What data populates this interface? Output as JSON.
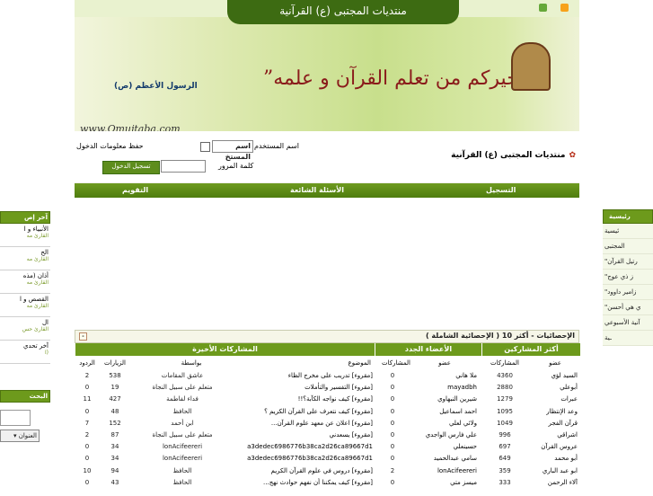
{
  "banner": {
    "header": "منتديات المجتبى (ع) القرآنية",
    "hadith": "“خيركم من تعلم القرآن و علمه”",
    "attribution": "الرسول الأعظم (ص)",
    "url": "www.Qmujtaba.com"
  },
  "login": {
    "site_title": "منتديات المجتبى (ع) القرآنية",
    "username_label": "اسم المستخدم",
    "username_value": "اسم المستخ",
    "remember_label": "حفظ معلومات الدخول",
    "password_label": "كلمة المرور",
    "login_button": "تسجيل الدخول"
  },
  "nav": {
    "register": "التسجيل",
    "faq": "الأسئلة الشائعة",
    "calendar": "التقويم"
  },
  "left_panel": {
    "head": "آخر إص",
    "items": [
      {
        "title": "الأنبياء و ا",
        "sub": "القارئ مه"
      },
      {
        "title": "الح",
        "sub": "القارئ مه"
      },
      {
        "title": "أذان (مذه",
        "sub": "القارئ مه"
      },
      {
        "title": "القصص و ا",
        "sub": "القارئ مه"
      },
      {
        "title": "ال",
        "sub": "القارئ حس"
      },
      {
        "title": "آخر تحدي",
        "sub": "(ا"
      }
    ],
    "search_head": "البحث",
    "search_option": "العنوان"
  },
  "right_panel": {
    "head": "رئيسية",
    "items": [
      "ئيسية",
      "المجتبى",
      "رتيل القرآن\"",
      "ز ذي عوج\"",
      "زامير داوود\"",
      "ي هي أحسن\"",
      "آنية الأسبوعي",
      "ـية"
    ]
  },
  "stats": {
    "title": "الإحصائيات - أكثر 10 ( الإحصائية الشاملة )",
    "toggle": "-",
    "col_top": "أكثر المشاركين",
    "col_new": "الأعضاء الجدد",
    "col_recent": "المشاركات الأخيرة",
    "sub_member": "عضو",
    "sub_posts": "المشاركات",
    "sub_topic": "الموضوع",
    "sub_by": "بواسطة",
    "sub_views": "الزيارات",
    "sub_replies": "الردود",
    "top_posters": [
      {
        "name": "السيد لؤي",
        "posts": "4360"
      },
      {
        "name": "أبوعلي",
        "posts": "2880"
      },
      {
        "name": "عبرات",
        "posts": "1279"
      },
      {
        "name": "وعد الإنتظار",
        "posts": "1095"
      },
      {
        "name": "قرآن الفجر",
        "posts": "1049"
      },
      {
        "name": "اشراقي",
        "posts": "996"
      },
      {
        "name": "عروس القرآن",
        "posts": "697"
      },
      {
        "name": "أبو محمد",
        "posts": "649"
      },
      {
        "name": "ابو عبد الباري",
        "posts": "359"
      },
      {
        "name": "آلاء الرحمن",
        "posts": "333"
      }
    ],
    "new_members": [
      {
        "name": "ملا هاني",
        "posts": "0"
      },
      {
        "name": "mayadbh",
        "posts": "0"
      },
      {
        "name": "شيرين النبهاوي",
        "posts": "0"
      },
      {
        "name": "احمد اسماعيل",
        "posts": "0"
      },
      {
        "name": "ولائي لعلي",
        "posts": "0"
      },
      {
        "name": "علي فارس الواجدي",
        "posts": "0"
      },
      {
        "name": "حسينعلي",
        "posts": "0"
      },
      {
        "name": "سامي عبدالحميد",
        "posts": "0"
      },
      {
        "name": "lonAcifeereri",
        "posts": "2"
      },
      {
        "name": "ميسز متي",
        "posts": "0"
      }
    ],
    "recent_posts": [
      {
        "topic": "[مقروء] تدريب على مخرج الظاء",
        "by": "عاشق المقامات",
        "views": "538",
        "replies": "2"
      },
      {
        "topic": "[مقروء] التفسير والتأملات",
        "by": "متعلم على سبيل النجاة",
        "views": "19",
        "replies": "0"
      },
      {
        "topic": "[مقروء] كيف نواجه الكآبة؟!!",
        "by": "فداء لفاطمة",
        "views": "427",
        "replies": "11"
      },
      {
        "topic": "[مقروء] كيف نتعرف على القرآن الكريم ؟",
        "by": "الحافظ",
        "views": "48",
        "replies": "0"
      },
      {
        "topic": "[مقروء] اعلان عن معهد علوم القرآن...",
        "by": "ابن أحمد",
        "views": "152",
        "replies": "7"
      },
      {
        "topic": "[مقروء] يسعدني",
        "by": "متعلم على سبيل النجاة",
        "views": "87",
        "replies": "2"
      },
      {
        "topic": "a3dedec6986776b38ca2d26ca89667d1",
        "by": "lonAcifeereri",
        "views": "34",
        "replies": "0"
      },
      {
        "topic": "a3dedec6986776b38ca2d26ca89667d1",
        "by": "lonAcifeereri",
        "views": "34",
        "replies": "0"
      },
      {
        "topic": "[مقروء] دروس في علوم القرآن الكريم",
        "by": "الحافظ",
        "views": "94",
        "replies": "10"
      },
      {
        "topic": "[مقروء] كيف يمكننا أن نفهم حوادث نهج...",
        "by": "الحافظ",
        "views": "43",
        "replies": "0"
      }
    ]
  }
}
